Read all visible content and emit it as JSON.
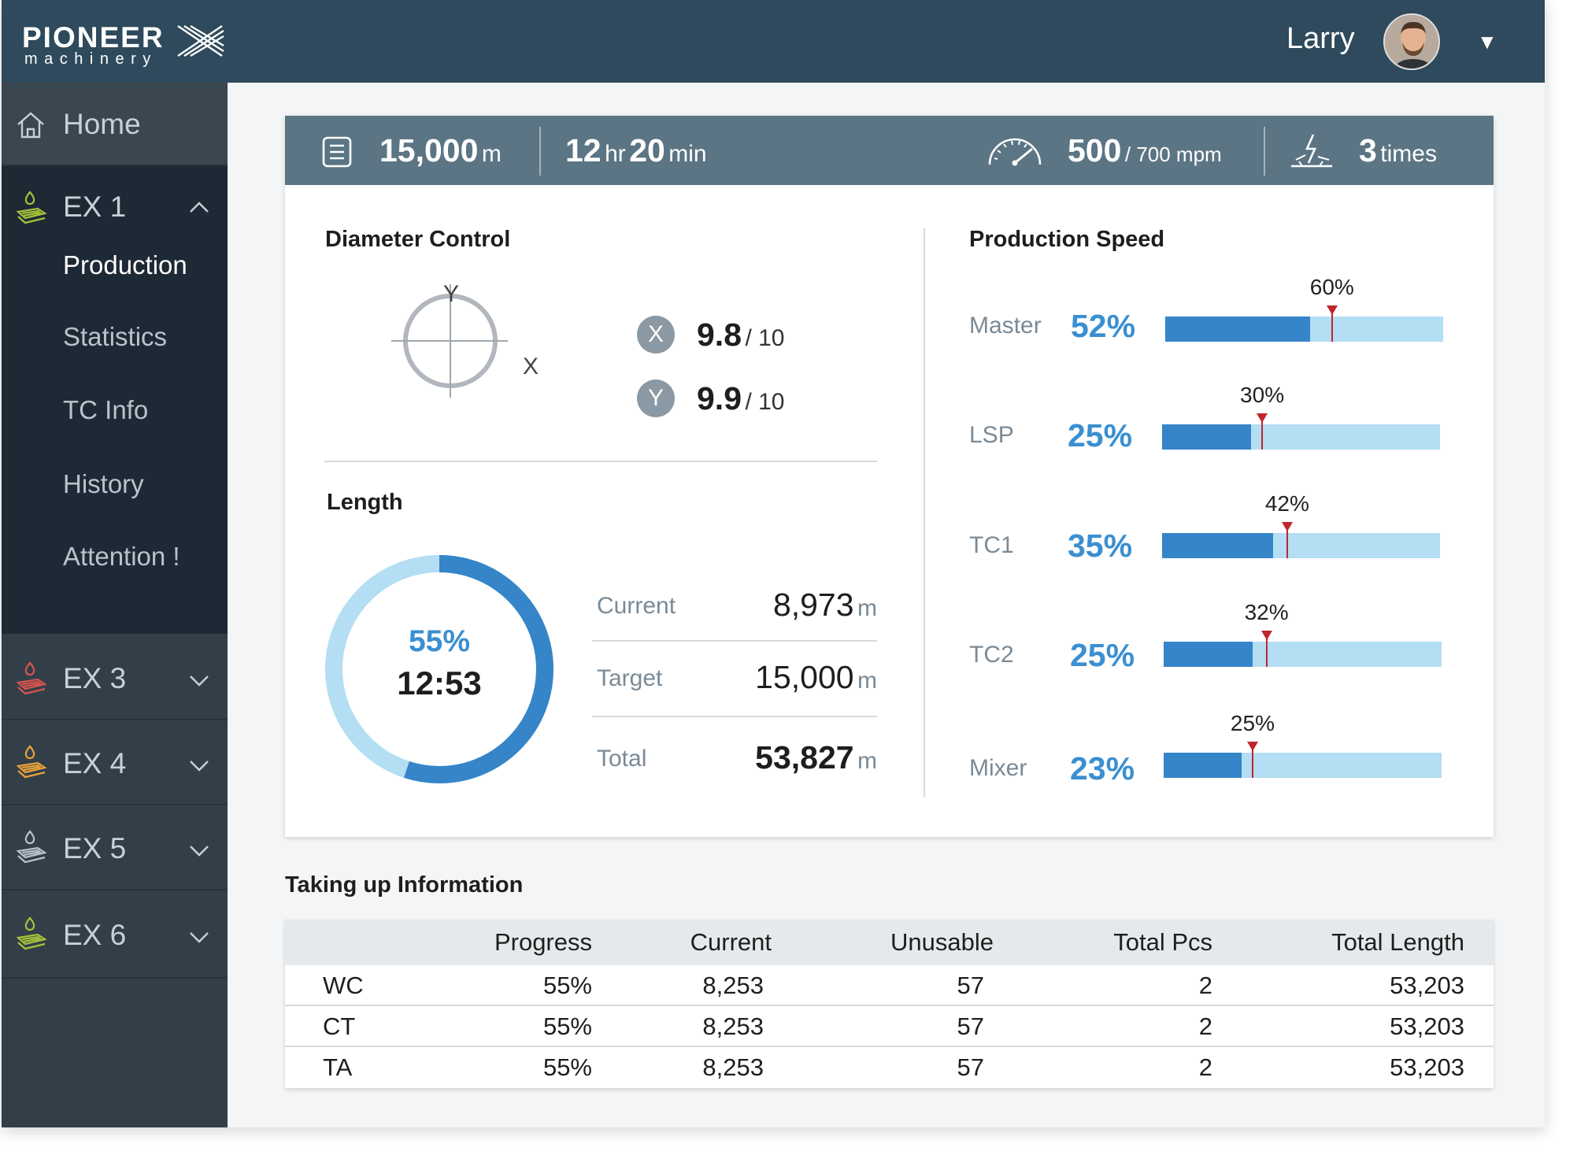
{
  "app": {
    "logo_top": "PIONEER",
    "logo_bottom": "machinery"
  },
  "user": {
    "name": "Larry"
  },
  "sidebar": {
    "home_label": "Home",
    "groups": [
      {
        "label": "EX 1",
        "expanded": true,
        "icon_color": "#a6c33a",
        "items": [
          "Production",
          "Statistics",
          "TC Info",
          "History",
          "Attention !"
        ],
        "active": "Production"
      },
      {
        "label": "EX 3",
        "expanded": false,
        "icon_color": "#d9534f"
      },
      {
        "label": "EX 4",
        "expanded": false,
        "icon_color": "#e9a23b"
      },
      {
        "label": "EX 5",
        "expanded": false,
        "icon_color": "#b8c3cb"
      },
      {
        "label": "EX 6",
        "expanded": false,
        "icon_color": "#a6c33a"
      }
    ]
  },
  "stats": {
    "length_value": "15,000",
    "length_unit": "m",
    "time_hr": "12",
    "time_hr_unit": "hr",
    "time_min": "20",
    "time_min_unit": "min",
    "speed_value": "500",
    "speed_max": "/ 700 mpm",
    "times_value": "3",
    "times_unit": "times"
  },
  "diameter": {
    "title": "Diameter Control",
    "axis_y": "Y",
    "axis_x": "X",
    "x_badge": "X",
    "x_value": "9.8",
    "x_of": "/ 10",
    "y_badge": "Y",
    "y_value": "9.9",
    "y_of": "/ 10"
  },
  "length": {
    "title": "Length",
    "progress_pct": "55%",
    "progress_fraction": 0.55,
    "time": "12:53",
    "rows": [
      {
        "label": "Current",
        "value": "8,973",
        "unit": "m"
      },
      {
        "label": "Target",
        "value": "15,000",
        "unit": "m"
      },
      {
        "label": "Total",
        "value": "53,827",
        "unit": "m"
      }
    ]
  },
  "production_speed": {
    "title": "Production Speed",
    "items": [
      {
        "label": "Master",
        "pct": "52%",
        "value": 0.52,
        "target_label": "60%",
        "target": 0.6
      },
      {
        "label": "LSP",
        "pct": "25%",
        "value": 0.32,
        "target_label": "30%",
        "target": 0.36
      },
      {
        "label": "TC1",
        "pct": "35%",
        "value": 0.4,
        "target_label": "42%",
        "target": 0.45
      },
      {
        "label": "TC2",
        "pct": "25%",
        "value": 0.32,
        "target_label": "32%",
        "target": 0.37
      },
      {
        "label": "Mixer",
        "pct": "23%",
        "value": 0.28,
        "target_label": "25%",
        "target": 0.32
      }
    ]
  },
  "taking_up": {
    "title": "Taking up Information",
    "headers": [
      "",
      "Progress",
      "Current",
      "Unusable",
      "Total Pcs",
      "Total Length"
    ],
    "rows": [
      [
        "WC",
        "55%",
        "8,253",
        "57",
        "2",
        "53,203"
      ],
      [
        "CT",
        "55%",
        "8,253",
        "57",
        "2",
        "53,203"
      ],
      [
        "TA",
        "55%",
        "8,253",
        "57",
        "2",
        "53,203"
      ]
    ]
  },
  "colors": {
    "topbar": "#2e4a5c",
    "sidebar": "#333f48",
    "statsbar": "#5b7584",
    "accent_blue": "#3a8fd1",
    "bar_fill": "#3585c8",
    "bar_track": "#b3def3",
    "marker_red": "#c0262c"
  }
}
